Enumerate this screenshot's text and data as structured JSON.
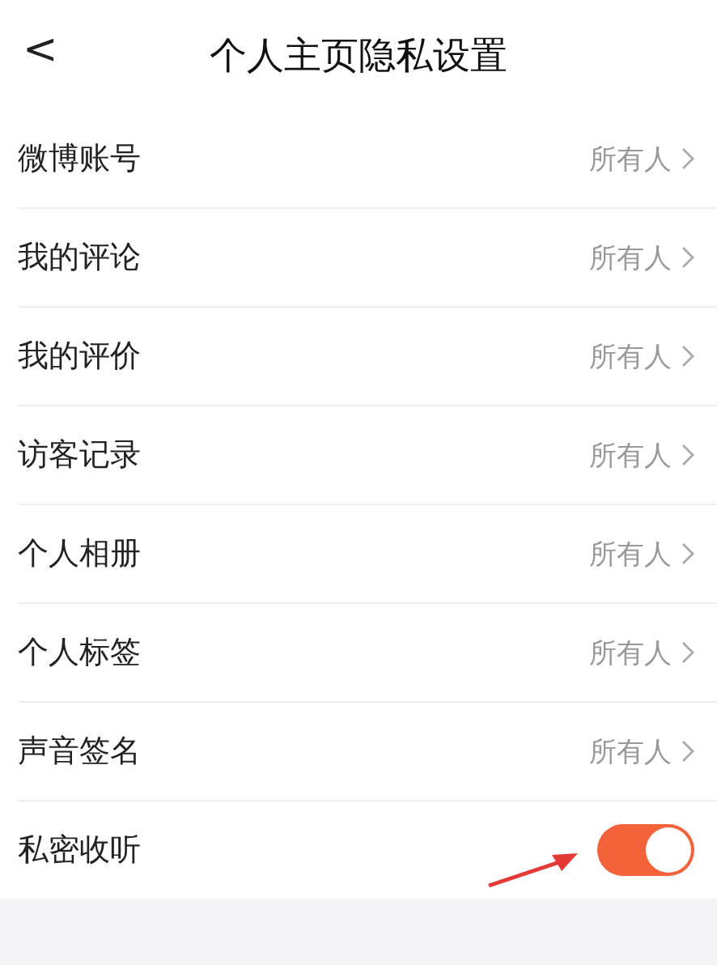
{
  "header": {
    "title": "个人主页隐私设置",
    "back": "<"
  },
  "rows": [
    {
      "kind": "option",
      "label": "微博账号",
      "value": "所有人"
    },
    {
      "kind": "option",
      "label": "我的评论",
      "value": "所有人"
    },
    {
      "kind": "option",
      "label": "我的评价",
      "value": "所有人"
    },
    {
      "kind": "option",
      "label": "访客记录",
      "value": "所有人"
    },
    {
      "kind": "option",
      "label": "个人相册",
      "value": "所有人"
    },
    {
      "kind": "option",
      "label": "个人标签",
      "value": "所有人"
    },
    {
      "kind": "option",
      "label": "声音签名",
      "value": "所有人"
    },
    {
      "kind": "toggle",
      "label": "私密收听",
      "on": true
    }
  ]
}
